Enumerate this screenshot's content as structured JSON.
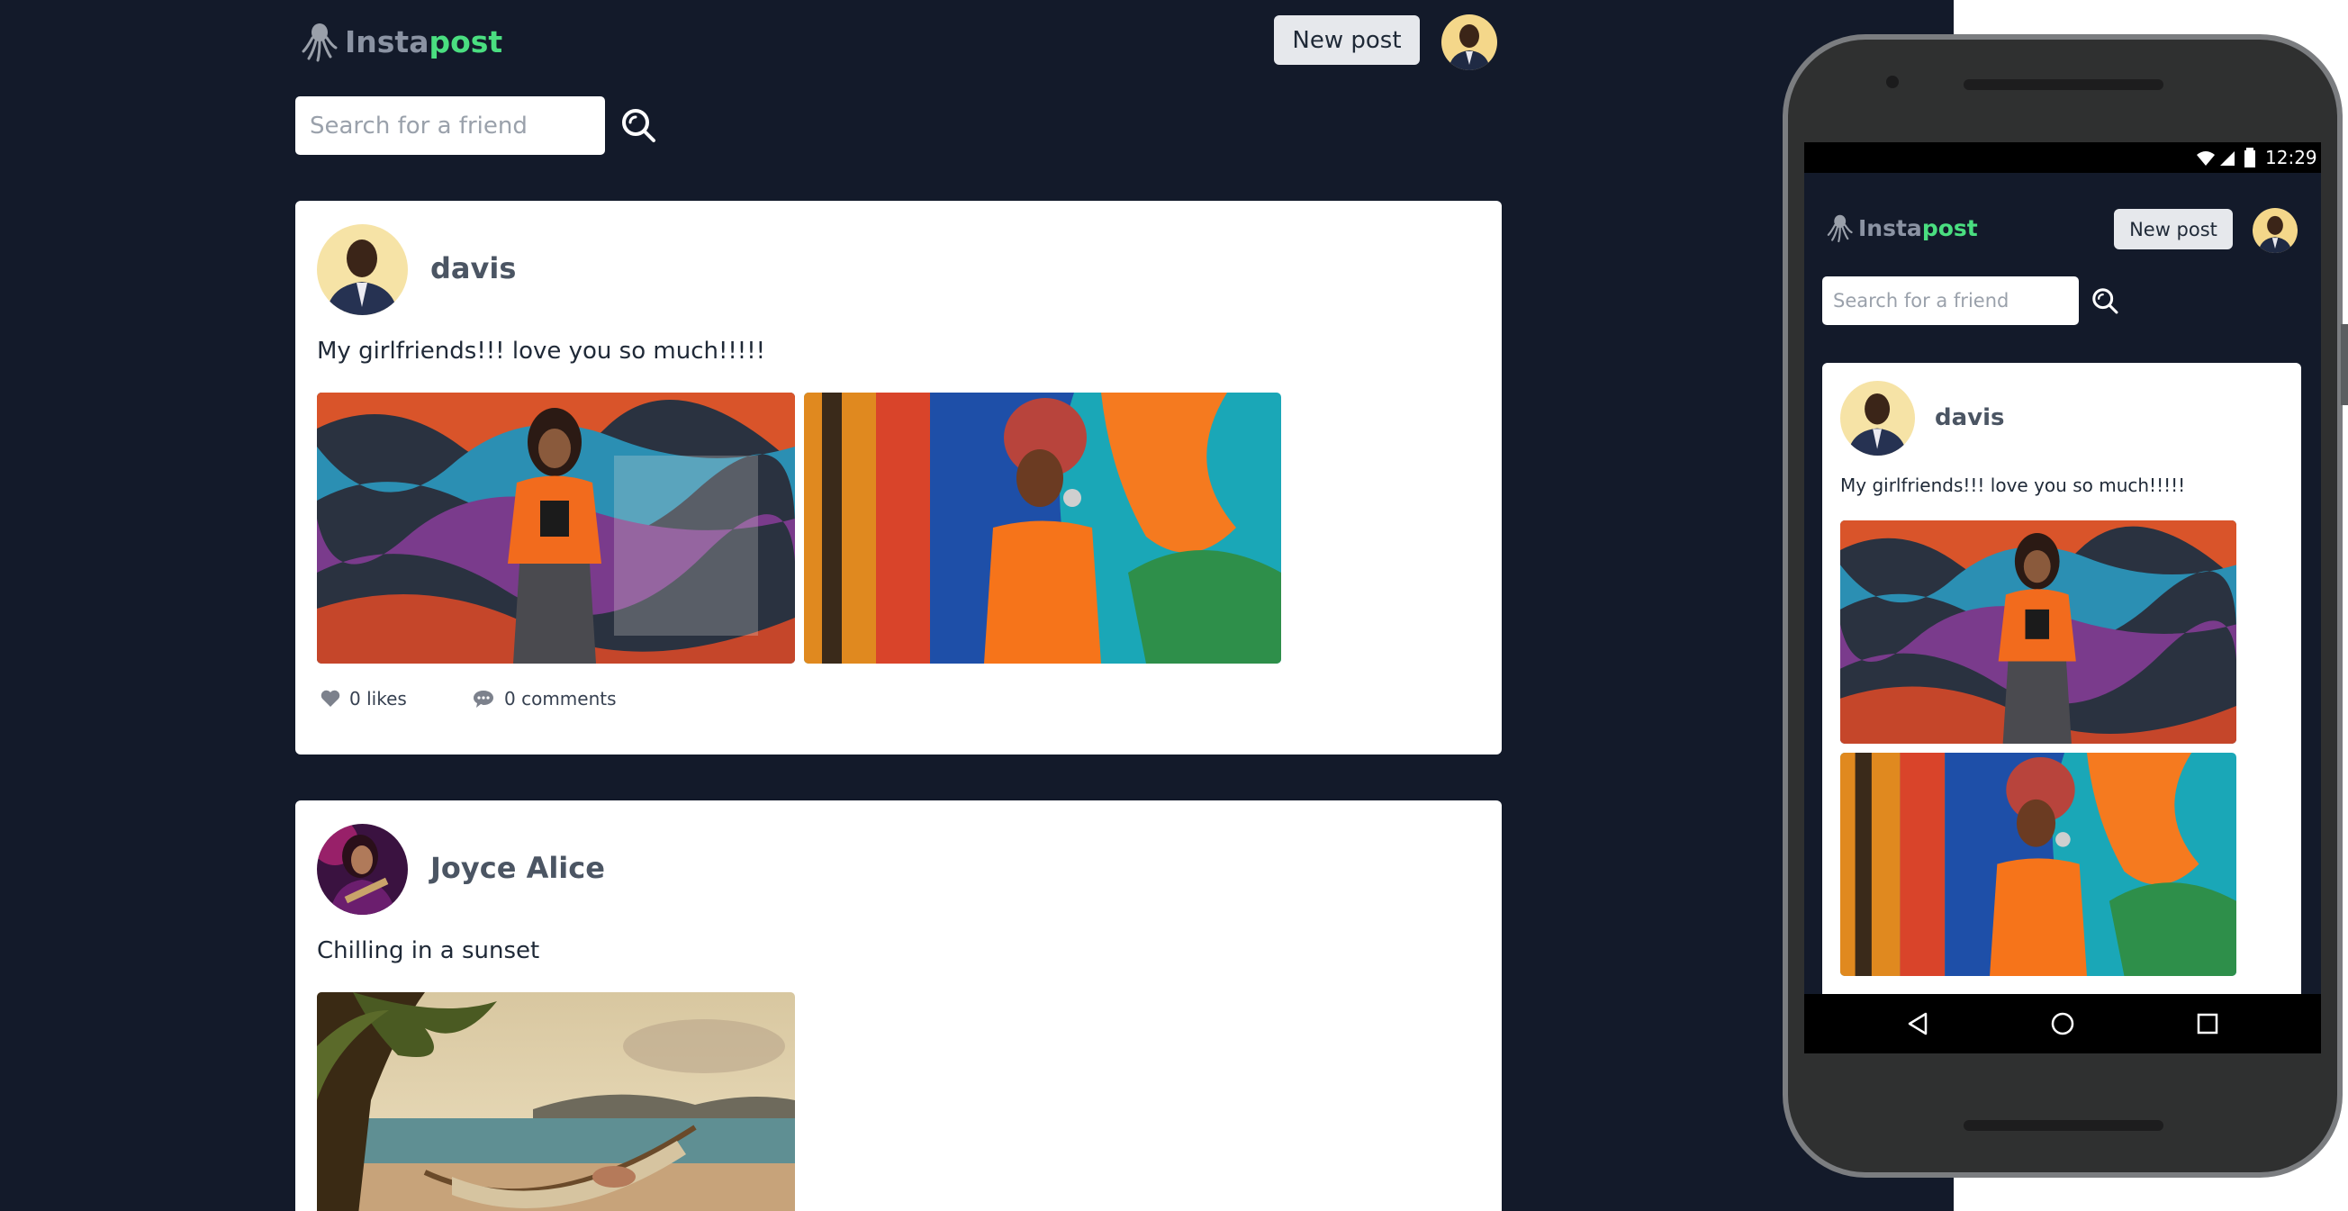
{
  "brand": {
    "part1": "Insta",
    "part2": "post"
  },
  "header": {
    "new_post_label": "New post"
  },
  "search": {
    "placeholder": "Search for a friend"
  },
  "posts": [
    {
      "username": "davis",
      "caption": "My girlfriends!!! love you so much!!!!!",
      "likes_label": "0 likes",
      "comments_label": "0 comments"
    },
    {
      "username": "Joyce Alice",
      "caption": "Chilling in a sunset"
    }
  ],
  "phone": {
    "time": "12:29"
  },
  "colors": {
    "background": "#131a2a",
    "accent": "#4ade80",
    "card": "#ffffff"
  }
}
